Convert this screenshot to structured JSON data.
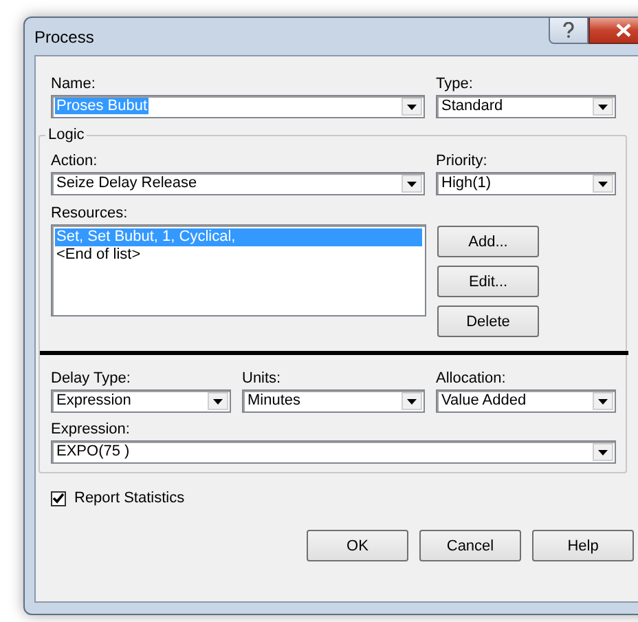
{
  "window": {
    "title": "Process"
  },
  "name": {
    "label": "Name:",
    "value": "Proses Bubut",
    "highlighted": true
  },
  "type": {
    "label": "Type:",
    "value": "Standard"
  },
  "logic": {
    "title": "Logic",
    "action": {
      "label": "Action:",
      "value": "Seize Delay Release"
    },
    "priority": {
      "label": "Priority:",
      "value": "High(1)"
    },
    "resources": {
      "label": "Resources:",
      "items": [
        {
          "text": "Set, Set Bubut, 1, Cyclical,",
          "selected": true
        },
        {
          "text": "<End of list>",
          "selected": false
        }
      ],
      "buttons": [
        "Add...",
        "Edit...",
        "Delete"
      ]
    },
    "delay_type": {
      "label": "Delay Type:",
      "value": "Expression"
    },
    "units": {
      "label": "Units:",
      "value": "Minutes"
    },
    "allocation": {
      "label": "Allocation:",
      "value": "Value Added"
    },
    "expression": {
      "label": "Expression:",
      "value": "EXPO(75 )"
    }
  },
  "report_statistics": {
    "label": "Report Statistics",
    "checked": true
  },
  "buttons": [
    "OK",
    "Cancel",
    "Help"
  ]
}
